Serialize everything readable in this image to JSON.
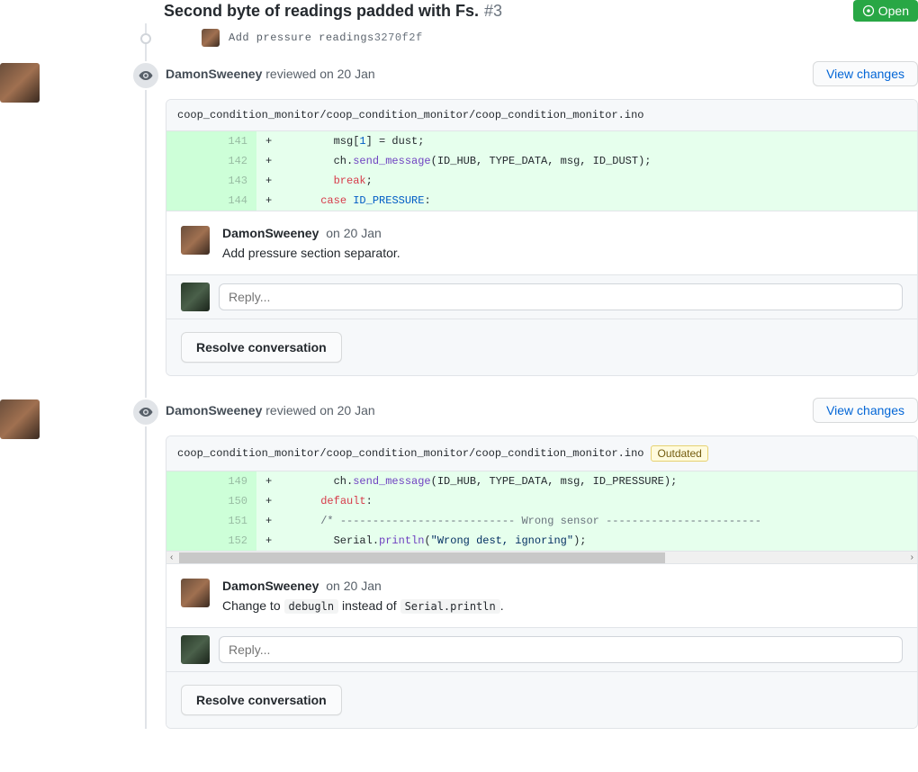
{
  "header": {
    "title": "Second byte of readings padded with Fs.",
    "issue_number": "#3",
    "status": "Open"
  },
  "commit": {
    "message": "Add pressure readings",
    "sha": "3270f2f"
  },
  "common": {
    "view_changes": "View changes",
    "resolve": "Resolve conversation",
    "reply_placeholder": "Reply..."
  },
  "reviews": [
    {
      "reviewer": "DamonSweeney",
      "action": "reviewed",
      "when": "on 20 Jan",
      "file": "coop_condition_monitor/coop_condition_monitor/coop_condition_monitor.ino",
      "outdated": false,
      "scroll": false,
      "lines": [
        {
          "n": 141,
          "html": "        msg[<span class='code-num'>1</span>] = dust;"
        },
        {
          "n": 142,
          "html": "        ch.<span class='code-fn'>send_message</span>(ID_HUB, TYPE_DATA, msg, ID_DUST);"
        },
        {
          "n": 143,
          "html": "        <span class='code-kw'>break</span>;"
        },
        {
          "n": 144,
          "html": "      <span class='code-kw'>case</span> <span class='code-const'>ID_PRESSURE</span>:"
        }
      ],
      "comment": {
        "author": "DamonSweeney",
        "when": "on 20 Jan",
        "text_html": "Add pressure section separator."
      }
    },
    {
      "reviewer": "DamonSweeney",
      "action": "reviewed",
      "when": "on 20 Jan",
      "file": "coop_condition_monitor/coop_condition_monitor/coop_condition_monitor.ino",
      "outdated": true,
      "scroll": true,
      "lines": [
        {
          "n": 149,
          "html": "        ch.<span class='code-fn'>send_message</span>(ID_HUB, TYPE_DATA, msg, ID_PRESSURE);"
        },
        {
          "n": 150,
          "html": "      <span class='code-kw'>default</span>:"
        },
        {
          "n": 151,
          "html": "      <span class='code-com'>/* --------------------------- Wrong sensor ------------------------</span>"
        },
        {
          "n": 152,
          "html": "        Serial.<span class='code-fn'>println</span>(<span class='code-str'>\"Wrong dest, ignoring\"</span>);"
        }
      ],
      "comment": {
        "author": "DamonSweeney",
        "when": "on 20 Jan",
        "text_html": "Change to <span class='code-inline'>debugln</span> instead of <span class='code-inline'>Serial.println</span>."
      }
    }
  ]
}
